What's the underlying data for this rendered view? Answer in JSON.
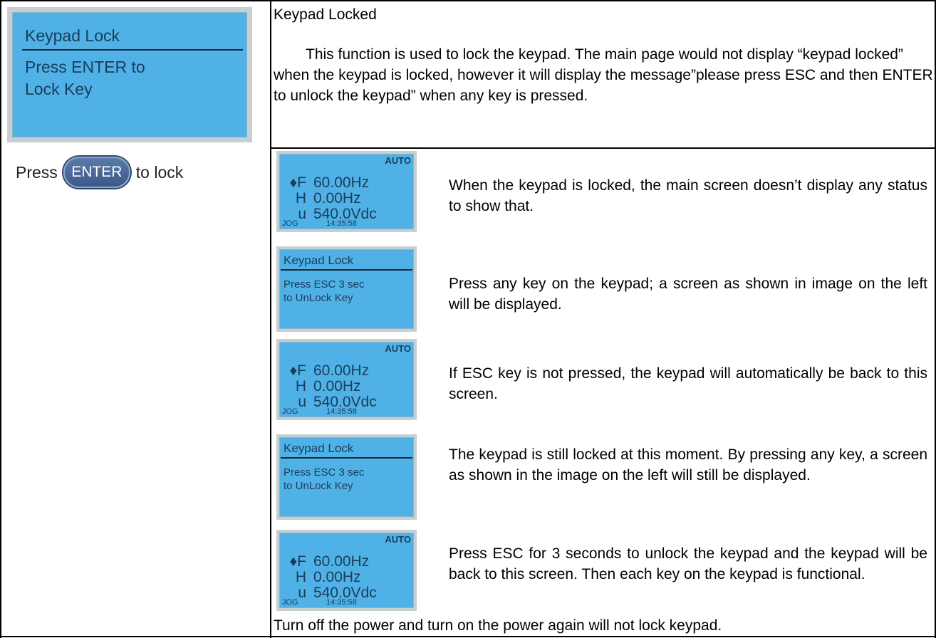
{
  "left": {
    "lcd": {
      "title": "Keypad Lock",
      "body_line1": "Press ENTER to",
      "body_line2": "Lock Key"
    },
    "press_before": "Press",
    "enter_key": "ENTER",
    "press_after": "to lock"
  },
  "right": {
    "title": "Keypad Locked",
    "paragraph": "This function is used to lock the keypad. The main page would not display “keypad locked” when the keypad is locked, however it will display the message”please press ESC and then ENTER to unlock the keypad” when any key is pressed.",
    "steps": [
      {
        "screen": {
          "auto": "AUTO",
          "f_prefix": "♦F",
          "f_value": "60.00Hz",
          "h_prefix": "H",
          "h_value": "0.00Hz",
          "u_prefix": "u",
          "u_value": "540.0Vdc",
          "jog": "JOG",
          "time": "14:35:58"
        },
        "text": "When the keypad is locked, the main screen doesn’t display any status to show that."
      },
      {
        "lock": {
          "title": "Keypad Lock",
          "line1": "Press ESC 3 sec",
          "line2": "to UnLock Key"
        },
        "text": "Press any key on the keypad; a screen as shown in image on the left will be displayed."
      },
      {
        "screen": {
          "auto": "AUTO",
          "f_prefix": "♦F",
          "f_value": "60.00Hz",
          "h_prefix": "H",
          "h_value": "0.00Hz",
          "u_prefix": "u",
          "u_value": "540.0Vdc",
          "jog": "JOG",
          "time": "14:35:58"
        },
        "text": "If ESC key is not pressed, the keypad will automatically be back to this screen."
      },
      {
        "lock": {
          "title": "Keypad Lock",
          "line1": "Press ESC 3 sec",
          "line2": "to UnLock Key"
        },
        "text": "The keypad is still locked at this moment. By pressing any key, a screen as shown in the image on the left will still be displayed."
      },
      {
        "screen": {
          "auto": "AUTO",
          "f_prefix": "♦F",
          "f_value": "60.00Hz",
          "h_prefix": "H",
          "h_value": "0.00Hz",
          "u_prefix": "u",
          "u_value": "540.0Vdc",
          "jog": "JOG",
          "time": "14:35:58"
        },
        "text": "Press ESC for 3 seconds to unlock the keypad and the keypad will be back to this screen. Then each key on the keypad is functional."
      }
    ],
    "footer": "Turn off the power and turn on the power again will not lock keypad."
  },
  "colors": {
    "lcd_bg": "#4fb1e6",
    "lcd_frame": "#c6cfd2",
    "enter_key": "#3a5888"
  }
}
